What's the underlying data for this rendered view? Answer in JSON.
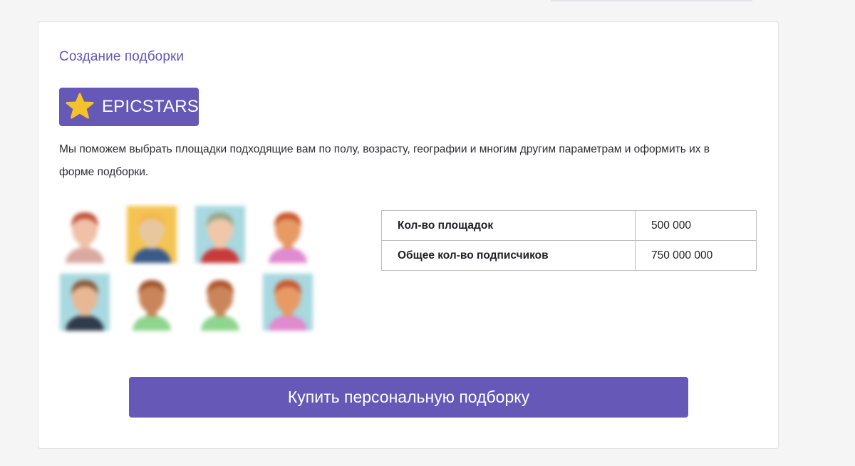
{
  "header": {
    "title": "Создание подборки"
  },
  "brand": {
    "name": "EPICSTARS",
    "icon": "star-icon",
    "color": "#6558b6",
    "star_color": "#f6c12a"
  },
  "description": "Мы поможем выбрать площадки подходящие вам по полу, возрасту, географии и многим другим параметрам и оформить их в форме подборки.",
  "stats": [
    {
      "label": "Кол-во площадок",
      "value": "500 000"
    },
    {
      "label": "Общее кол-во подписчиков",
      "value": "750 000 000"
    }
  ],
  "buy_button": {
    "label": "Купить персональную подборку"
  },
  "avatars": [
    {
      "hair": "#c2523a",
      "bg": "#ffffff",
      "shirt": "#d9a9a0",
      "skin": "#f0c0a8"
    },
    {
      "hair": "#f3b84c",
      "bg": "#f4c452",
      "shirt": "#3a5a8a",
      "skin": "#e8c79e"
    },
    {
      "hair": "#9aa68a",
      "bg": "#a8d8e0",
      "shirt": "#c83a3a",
      "skin": "#f0c7a8"
    },
    {
      "hair": "#c9552e",
      "bg": "#ffffff",
      "shirt": "#e08ad0",
      "skin": "#e79a64"
    },
    {
      "hair": "#8a5a3a",
      "bg": "#a8d8e0",
      "shirt": "#2f3a4a",
      "skin": "#e8b894"
    },
    {
      "hair": "#a0522d",
      "bg": "#ffffff",
      "shirt": "#8ed58e",
      "skin": "#c9865a"
    },
    {
      "hair": "#b0532d",
      "bg": "#ffffff",
      "shirt": "#8ed58e",
      "skin": "#c9865a"
    },
    {
      "hair": "#c9552e",
      "bg": "#a8d8e0",
      "shirt": "#e08ad0",
      "skin": "#e79a64"
    }
  ]
}
